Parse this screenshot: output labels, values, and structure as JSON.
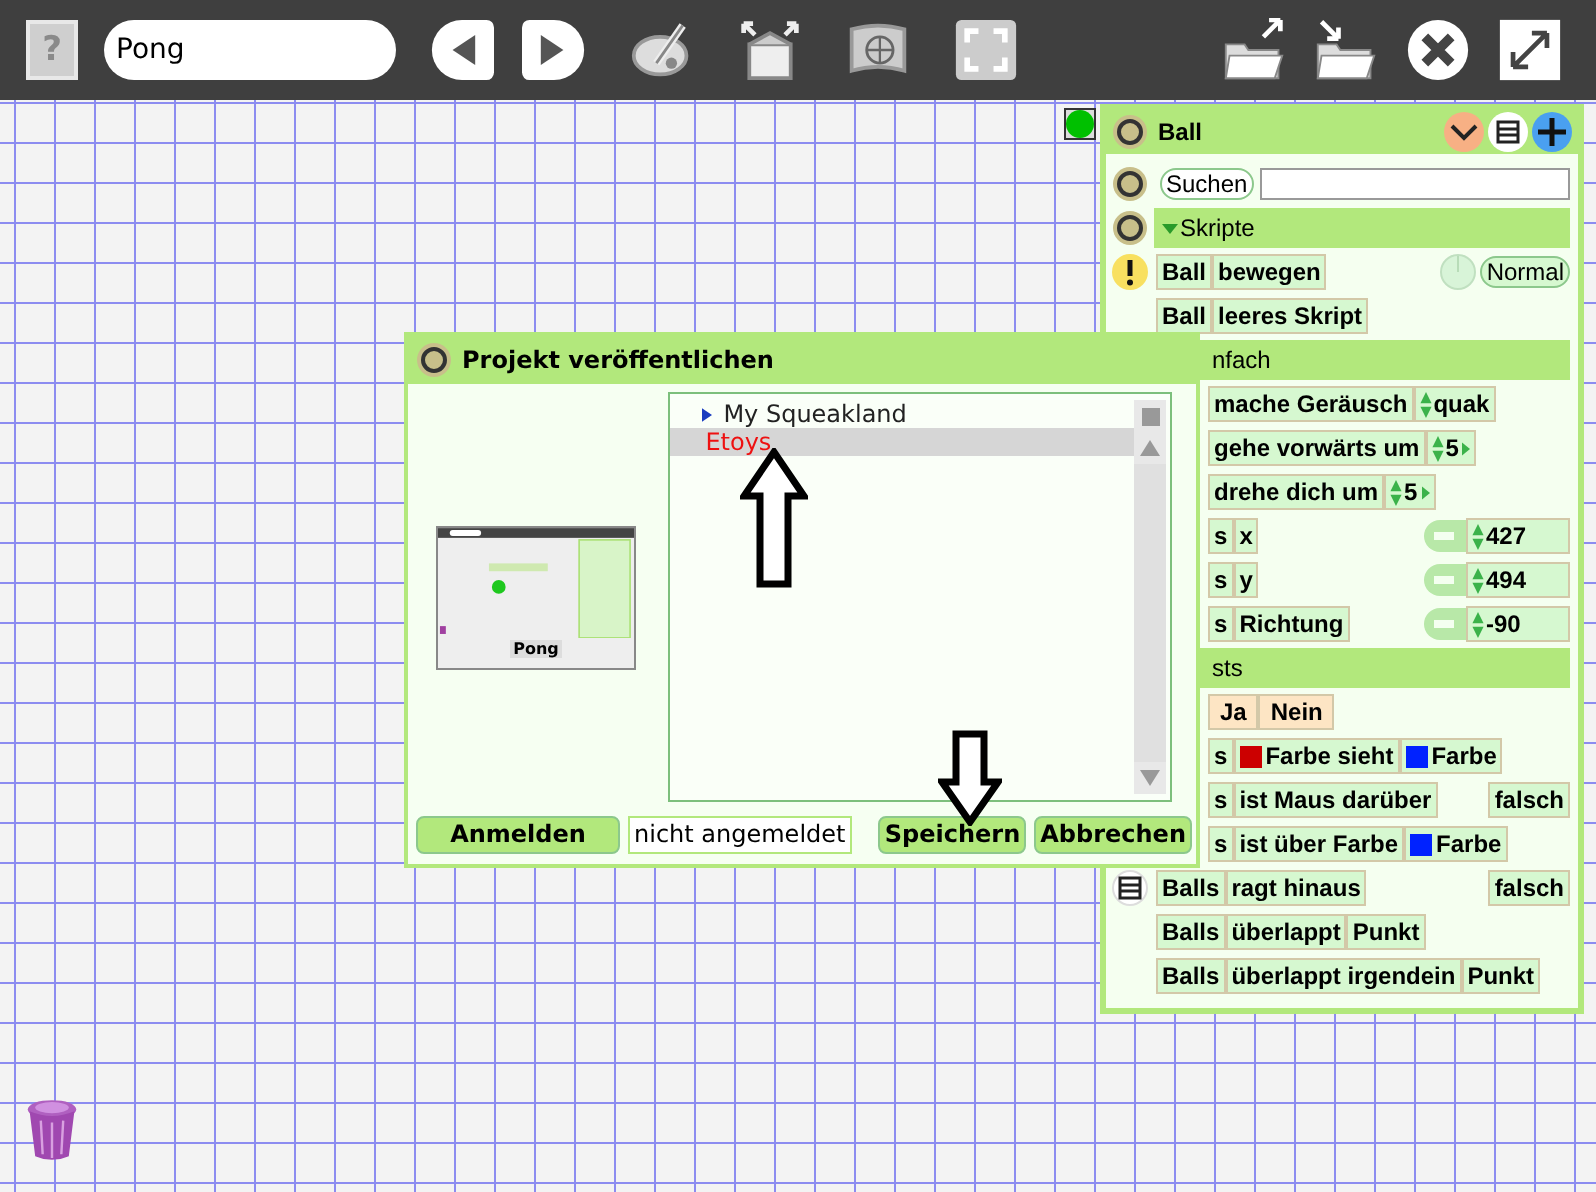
{
  "toolbar": {
    "help_glyph": "?",
    "project_name": "Pong"
  },
  "viewer": {
    "title": "Ball",
    "search_label": "Suchen",
    "rows": [
      {
        "kind": "section",
        "text": "Skripte",
        "expanded": true
      },
      {
        "kind": "tiles",
        "lead": {
          "kind": "alert"
        },
        "tiles": [
          {
            "kind": "object",
            "text": "Ball"
          },
          {
            "kind": "command",
            "text": "bewegen"
          }
        ],
        "status": {
          "kind": "button",
          "text": "Normal"
        }
      },
      {
        "kind": "tiles",
        "tiles": [
          {
            "kind": "object",
            "text": "Ball"
          },
          {
            "kind": "command",
            "text": "leeres Skript"
          }
        ]
      },
      {
        "kind": "header-cut",
        "text": "nfach"
      },
      {
        "kind": "tiles-cut",
        "tiles": [
          {
            "kind": "command",
            "text": "mache Geräusch"
          },
          {
            "kind": "param",
            "text": "quak"
          }
        ]
      },
      {
        "kind": "tiles-cut",
        "tiles": [
          {
            "kind": "command",
            "text": "gehe vorwärts um"
          },
          {
            "kind": "number",
            "text": "5"
          }
        ]
      },
      {
        "kind": "tiles-cut",
        "tiles": [
          {
            "kind": "command",
            "text": "drehe dich um"
          },
          {
            "kind": "number",
            "text": "5"
          }
        ]
      },
      {
        "kind": "tiles-cut",
        "tiles": [
          {
            "kind": "object",
            "text": "s"
          },
          {
            "kind": "command",
            "text": "x"
          }
        ],
        "readout": {
          "kind": "number",
          "text": "427"
        }
      },
      {
        "kind": "tiles-cut",
        "tiles": [
          {
            "kind": "object",
            "text": "s"
          },
          {
            "kind": "command",
            "text": "y"
          }
        ],
        "readout": {
          "kind": "number",
          "text": "494"
        }
      },
      {
        "kind": "tiles-cut",
        "tiles": [
          {
            "kind": "object",
            "text": "s"
          },
          {
            "kind": "command",
            "text": "Richtung"
          }
        ],
        "readout": {
          "kind": "number",
          "text": "-90"
        }
      },
      {
        "kind": "header-cut",
        "text": "sts"
      },
      {
        "kind": "tiles-cut",
        "tiles": [
          {
            "kind": "choice",
            "text": "Ja"
          },
          {
            "kind": "choice",
            "text": "Nein"
          }
        ]
      },
      {
        "kind": "tiles-cut",
        "tiles": [
          {
            "kind": "object",
            "text": "s"
          },
          {
            "kind": "command",
            "text": "Farbe sieht",
            "color": "#cc0000"
          },
          {
            "kind": "command",
            "text": "Farbe",
            "color": "#0022ff"
          }
        ]
      },
      {
        "kind": "tiles-cut",
        "tiles": [
          {
            "kind": "object",
            "text": "s"
          },
          {
            "kind": "command",
            "text": "ist Maus darüber"
          }
        ],
        "readout": {
          "kind": "boolean",
          "text": "falsch"
        }
      },
      {
        "kind": "tiles-cut",
        "tiles": [
          {
            "kind": "object",
            "text": "s"
          },
          {
            "kind": "command",
            "text": "ist über Farbe"
          },
          {
            "kind": "command",
            "text": "Farbe",
            "color": "#0022ff"
          }
        ]
      },
      {
        "kind": "tiles",
        "lead": {
          "kind": "menu"
        },
        "tiles": [
          {
            "kind": "object",
            "text": "Balls"
          },
          {
            "kind": "command",
            "text": "ragt hinaus"
          }
        ],
        "readout": {
          "kind": "boolean",
          "text": "falsch"
        }
      },
      {
        "kind": "tiles",
        "tiles": [
          {
            "kind": "object",
            "text": "Balls"
          },
          {
            "kind": "command",
            "text": "überlappt"
          },
          {
            "kind": "command",
            "text": "Punkt"
          }
        ]
      },
      {
        "kind": "tiles",
        "tiles": [
          {
            "kind": "object",
            "text": "Balls"
          },
          {
            "kind": "command",
            "text": "überlappt irgendein"
          },
          {
            "kind": "command",
            "text": "Punkt"
          }
        ]
      }
    ]
  },
  "dialog": {
    "title": "Projekt veröffentlichen",
    "thumbnail_label": "Pong",
    "tree": [
      {
        "text": "My Squeakland",
        "selected": false,
        "children": [
          {
            "text": "Etoys",
            "selected": true
          }
        ]
      }
    ],
    "login_button": "Anmelden",
    "login_status": "nicht angemeldet",
    "save_button": "Speichern",
    "cancel_button": "Abbrechen"
  }
}
